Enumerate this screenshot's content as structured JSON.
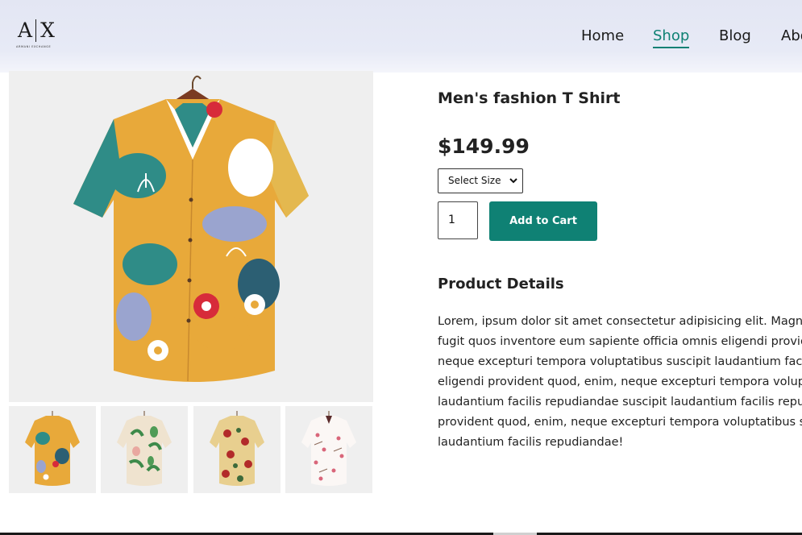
{
  "brand": {
    "logo_text": "A|X",
    "logo_subtext": "ARMANI EXCHANGE"
  },
  "nav": {
    "items": [
      "Home",
      "Shop",
      "Blog",
      "Abo"
    ],
    "active": "Shop"
  },
  "product": {
    "title": "Men's fashion T Shirt",
    "price": "$149.99",
    "size_select": "Select Size",
    "quantity": "1",
    "add_to_cart": "Add to Cart"
  },
  "details": {
    "heading": "Product Details",
    "lines": [
      "Lorem, ipsum dolor sit amet consectetur adipisicing elit. Magni la",
      "fugit quos inventore eum sapiente officia omnis eligendi provide",
      "neque excepturi tempora voluptatibus suscipit laudantium facilis",
      "eligendi provident quod, enim, neque excepturi tempora volupta",
      "laudantium facilis repudiandae suscipit laudantium facilis repudi",
      "provident quod, enim, neque excepturi tempora voluptatibus sus",
      "laudantium facilis repudiandae!"
    ]
  },
  "images": {
    "main": "abstract-floral-shirt-image",
    "thumbnails": [
      "abstract-floral-shirt-thumbnail",
      "tropical-leaf-shirt-thumbnail",
      "red-floral-shirt-thumbnail",
      "white-blossom-shirt-thumbnail"
    ]
  },
  "colors": {
    "accent": "#0f8174",
    "header_bg": "#e3e6f3",
    "image_bg": "#efefef"
  }
}
